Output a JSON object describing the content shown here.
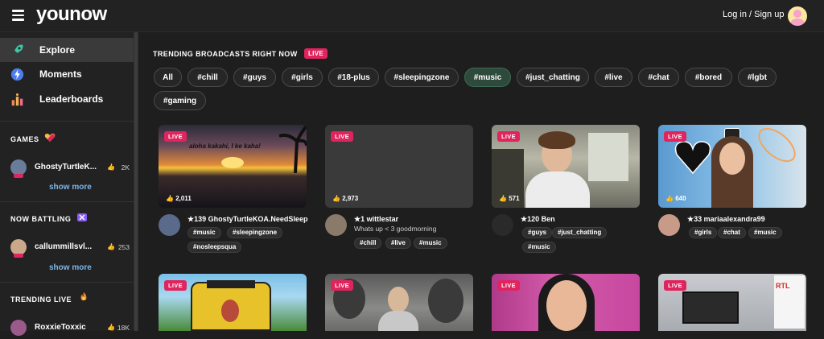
{
  "header": {
    "logo": "younow",
    "login_label": "Log in / Sign up"
  },
  "sidebar": {
    "nav": [
      {
        "label": "Explore",
        "icon": "rocket-icon",
        "active": true
      },
      {
        "label": "Moments",
        "icon": "bolt-icon",
        "active": false
      },
      {
        "label": "Leaderboards",
        "icon": "leaderboard-icon",
        "active": false
      }
    ],
    "games": {
      "title": "GAMES",
      "user": "GhostyTurtleK...",
      "count": "2K",
      "show_more": "show more"
    },
    "battling": {
      "title": "NOW BATTLING",
      "user": "callummillsvl...",
      "count": "253",
      "show_more": "show more"
    },
    "trending": {
      "title": "TRENDING LIVE",
      "user": "RoxxieToxxic",
      "count": "18K"
    }
  },
  "main": {
    "title": "TRENDING BROADCASTS RIGHT NOW",
    "live_label": "LIVE",
    "chips": [
      "All",
      "#chill",
      "#guys",
      "#girls",
      "#18-plus",
      "#sleepingzone",
      "#music",
      "#just_chatting",
      "#live",
      "#chat",
      "#bored",
      "#lgbt",
      "#gaming"
    ],
    "active_chip": "#music",
    "cards": [
      {
        "likes": "2,011",
        "user": "★139 GhostyTurtleKOA.NeedSleep",
        "subtitle": "",
        "tags": [
          "#music",
          "#sleepingzone",
          "#nosleepsqua"
        ],
        "overlay": "aloha kakahi, I ke kaha!"
      },
      {
        "likes": "2,973",
        "user": "★1 wittlestar",
        "subtitle": "Whats up < 3 goodmorning",
        "tags": [
          "#chill",
          "#live",
          "#music"
        ]
      },
      {
        "likes": "571",
        "user": "★120 Ben",
        "subtitle": "",
        "tags": [
          "#guys",
          "#just_chatting",
          "#music"
        ]
      },
      {
        "likes": "640",
        "user": "★33 mariaalexandra99",
        "subtitle": "",
        "tags": [
          "#girls",
          "#chat",
          "#music"
        ]
      }
    ]
  },
  "colors": {
    "accent_live": "#e0245e",
    "link": "#7db6e8",
    "active_chip": "#2e4a3c"
  }
}
